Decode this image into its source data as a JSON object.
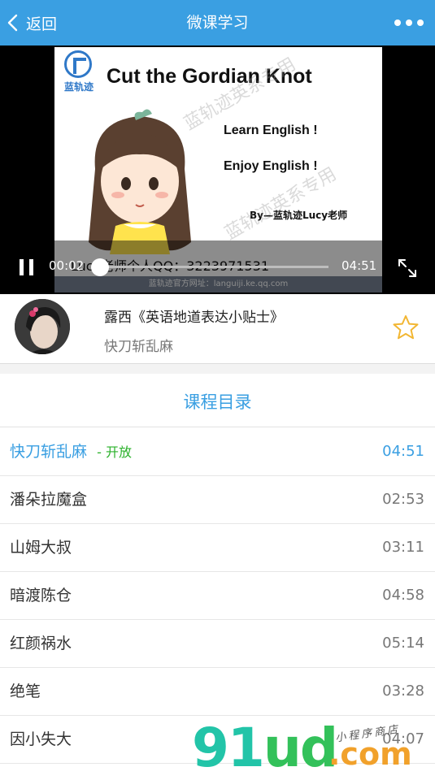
{
  "header": {
    "back_label": "返回",
    "title": "微课学习"
  },
  "video": {
    "slide": {
      "logo_text": "蓝轨迹",
      "title": "Cut the Gordian Knot",
      "line1": "Learn English !",
      "line2": "Enjoy English !",
      "byline": "By—蓝轨迹Lucy老师",
      "qq": "Lucy老师个人QQ：3223971531",
      "url": "蓝轨迹官方网址：languiji.ke.qq.com",
      "watermark": "蓝轨迹英系专用"
    },
    "current_time": "00:02",
    "duration": "04:51",
    "progress": 0.01
  },
  "course": {
    "title": "露西《英语地道表达小贴士》",
    "subtitle": "快刀斩乱麻"
  },
  "catalog": {
    "title": "课程目录",
    "items": [
      {
        "name": "快刀斩乱麻",
        "badge_dash": "-",
        "badge": "开放",
        "time": "04:51"
      },
      {
        "name": "潘朵拉魔盒",
        "time": "02:53"
      },
      {
        "name": "山姆大叔",
        "time": "03:11"
      },
      {
        "name": "暗渡陈仓",
        "time": "04:58"
      },
      {
        "name": "红颜祸水",
        "time": "05:14"
      },
      {
        "name": "绝笔",
        "time": "03:28"
      },
      {
        "name": "因小失大",
        "time": "04:07"
      }
    ]
  },
  "brand": {
    "main_a": "91",
    "main_b": "ud",
    "dot_com": ".com",
    "script": "小程序商店"
  },
  "colors": {
    "header_bg": "#3a9fe2",
    "accent": "#3a9fe2",
    "badge_green": "#2bb12b",
    "star": "#f2b632"
  }
}
